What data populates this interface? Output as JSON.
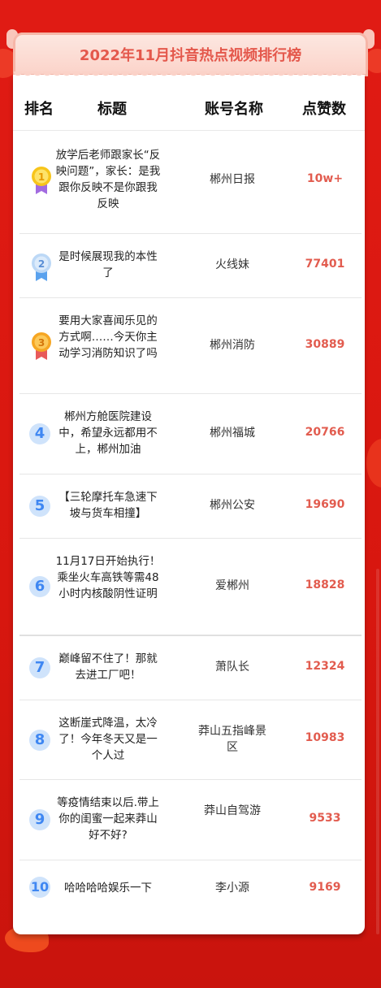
{
  "page": {
    "title": "2022年11月抖音热点视频排行榜"
  },
  "columns": {
    "rank": "排名",
    "title": "标题",
    "account": "账号名称",
    "likes": "点赞数"
  },
  "colors": {
    "accent": "#e4584c",
    "background": "#e01b14",
    "rank_badge": "#cfe3fb",
    "rank_text": "#3f87f2"
  },
  "rows": [
    {
      "rank": "1",
      "medal": "gold-medal-icon",
      "title": "放学后老师跟家长“反映问题”，家长：是我跟你反映不是你跟我反映",
      "account": "郴州日报",
      "likes": "10w+"
    },
    {
      "rank": "2",
      "medal": "silver-medal-icon",
      "title": "是时候展现我的本性了",
      "account": "火线妹",
      "likes": "77401"
    },
    {
      "rank": "3",
      "medal": "bronze-medal-icon",
      "title": "要用大家喜闻乐见的方式啊……今天你主动学习消防知识了吗",
      "account": "郴州消防",
      "likes": "30889"
    },
    {
      "rank": "4",
      "title": "郴州方舱医院建设中，希望永远都用不上，郴州加油",
      "account": "郴州福城",
      "likes": "20766"
    },
    {
      "rank": "5",
      "title": "【三轮摩托车急速下坡与货车相撞】",
      "account": "郴州公安",
      "likes": "19690"
    },
    {
      "rank": "6",
      "title": "11月17日开始执行！乘坐火车高铁等需48小时内核酸阴性证明",
      "account": "爱郴州",
      "likes": "18828"
    },
    {
      "rank": "7",
      "title": "巅峰留不住了！那就去进工厂吧！",
      "account": "萧队长",
      "likes": "12324"
    },
    {
      "rank": "8",
      "title": "这断崖式降温，太冷了！今年冬天又是一个人过",
      "account": "莽山五指峰景区",
      "likes": "10983"
    },
    {
      "rank": "9",
      "title": "等疫情结束以后.带上你的闺蜜一起来莽山好不好?",
      "account": "莽山自驾游",
      "likes": "9533"
    },
    {
      "rank": "10",
      "title": "哈哈哈哈娱乐一下",
      "account": "李小源",
      "likes": "9169"
    }
  ]
}
